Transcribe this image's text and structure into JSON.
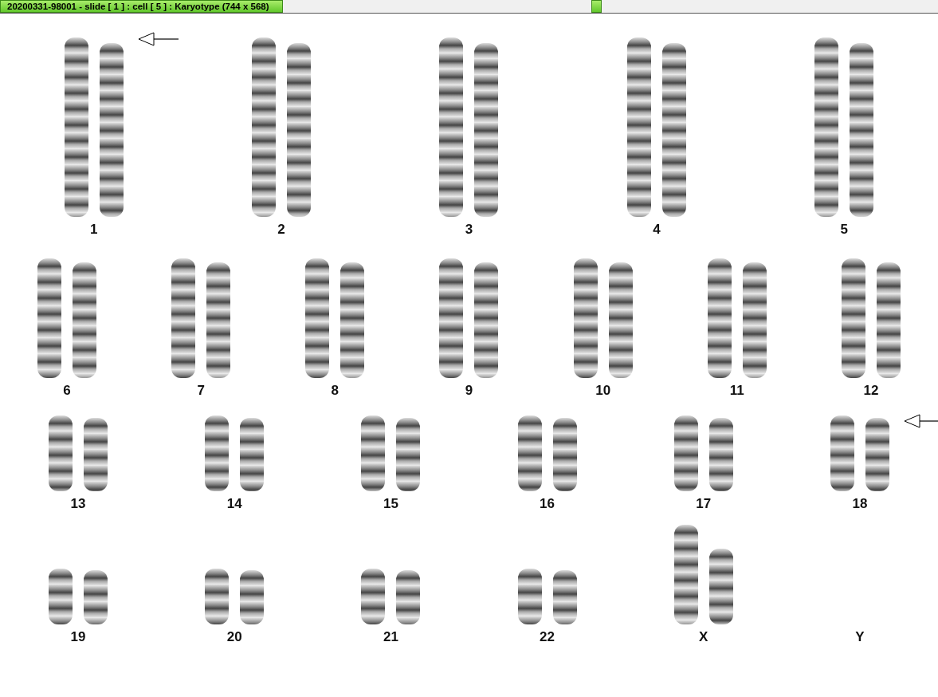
{
  "window": {
    "title": "20200331-98001 - slide [ 1 ] : cell [ 5 ] : Karyotype  (744 x 568)"
  },
  "karyotype_rows": [
    {
      "items": [
        {
          "label": "1",
          "kind": "pair",
          "marked": true
        },
        {
          "label": "2",
          "kind": "pair",
          "marked": false
        },
        {
          "label": "3",
          "kind": "pair",
          "marked": false
        },
        {
          "label": "4",
          "kind": "pair",
          "marked": false
        },
        {
          "label": "5",
          "kind": "pair",
          "marked": false
        }
      ]
    },
    {
      "items": [
        {
          "label": "6",
          "kind": "pair",
          "marked": false
        },
        {
          "label": "7",
          "kind": "pair",
          "marked": false
        },
        {
          "label": "8",
          "kind": "pair",
          "marked": false
        },
        {
          "label": "9",
          "kind": "pair",
          "marked": false
        },
        {
          "label": "10",
          "kind": "pair",
          "marked": false
        },
        {
          "label": "11",
          "kind": "pair",
          "marked": false
        },
        {
          "label": "12",
          "kind": "pair",
          "marked": false
        }
      ]
    },
    {
      "items": [
        {
          "label": "13",
          "kind": "pair",
          "marked": false
        },
        {
          "label": "14",
          "kind": "pair",
          "marked": false
        },
        {
          "label": "15",
          "kind": "pair",
          "marked": false
        },
        {
          "label": "16",
          "kind": "pair",
          "marked": false
        },
        {
          "label": "17",
          "kind": "pair",
          "marked": false
        },
        {
          "label": "18",
          "kind": "pair",
          "marked": true
        }
      ]
    },
    {
      "items": [
        {
          "label": "19",
          "kind": "pair",
          "marked": false
        },
        {
          "label": "20",
          "kind": "pair",
          "marked": false
        },
        {
          "label": "21",
          "kind": "pair",
          "marked": false
        },
        {
          "label": "22",
          "kind": "pair",
          "marked": false
        },
        {
          "label": "X",
          "kind": "large-pair",
          "marked": false
        },
        {
          "label": "Y",
          "kind": "empty",
          "marked": false
        }
      ]
    }
  ]
}
